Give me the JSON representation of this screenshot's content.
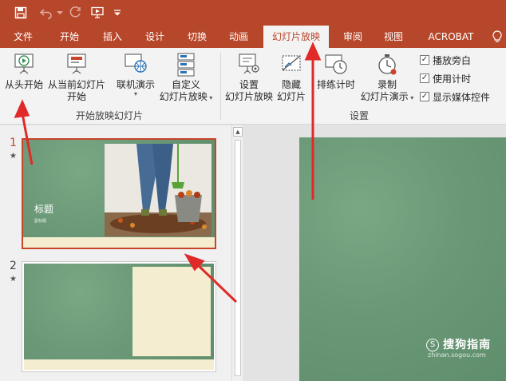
{
  "quick_access": [
    "save-icon",
    "undo-icon",
    "redo-icon",
    "present-from-start-icon",
    "customize-qat-icon"
  ],
  "tabs": [
    "文件",
    "开始",
    "插入",
    "设计",
    "切换",
    "动画",
    "幻灯片放映",
    "审阅",
    "视图",
    "ACROBAT"
  ],
  "active_tab": "幻灯片放映",
  "tell_me_icon": "lightbulb-icon",
  "ribbon": {
    "start": {
      "from_beginning": "从头开始",
      "from_current_1": "从当前幻灯片",
      "from_current_2": "开始",
      "online_present": "联机演示",
      "custom_1": "自定义",
      "custom_2": "幻灯片放映",
      "group_label": "开始放映幻灯片"
    },
    "setup": {
      "setup_1": "设置",
      "setup_2": "幻灯片放映",
      "hide_1": "隐藏",
      "hide_2": "幻灯片",
      "rehearse": "排练计时",
      "record_1": "录制",
      "record_2": "幻灯片演示",
      "group_label": "设置"
    },
    "checkboxes": [
      {
        "label": "播放旁白",
        "checked": true
      },
      {
        "label": "使用计时",
        "checked": true
      },
      {
        "label": "显示媒体控件",
        "checked": true
      }
    ]
  },
  "slides": [
    {
      "number": "1",
      "title": "标题",
      "subtitle": "副标题"
    },
    {
      "number": "2"
    }
  ],
  "watermark": {
    "text": "搜狗指南",
    "url": "zhinan.sogou.com"
  },
  "colors": {
    "accent": "#b7472a",
    "slide_green": "#6d9a78",
    "annotation_red": "#e02a2a"
  }
}
